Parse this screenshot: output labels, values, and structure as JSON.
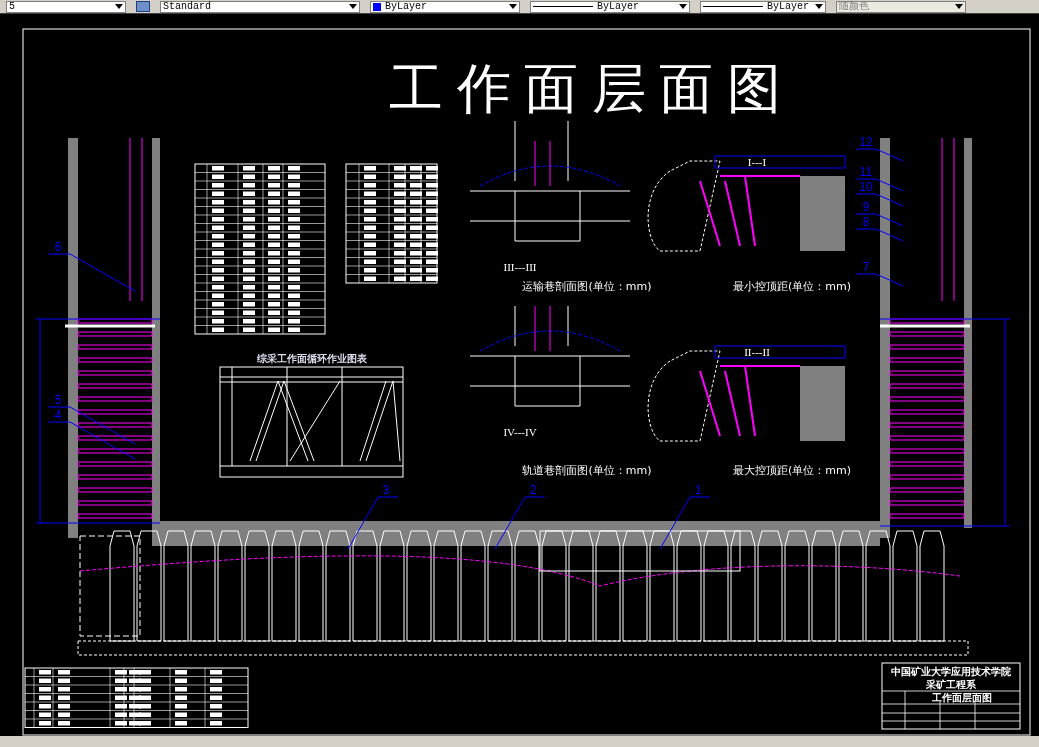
{
  "toolbar": [
    {
      "kind": "text-style",
      "value": "5"
    },
    {
      "kind": "dim-style",
      "value": "Standard"
    },
    {
      "kind": "color",
      "value": "ByLayer"
    },
    {
      "kind": "linetype",
      "value": "ByLayer"
    },
    {
      "kind": "lineweight",
      "value": "ByLayer"
    },
    {
      "kind": "plot-style",
      "value": "随颜色",
      "disabled": true
    }
  ],
  "drawing": {
    "title": "工 作 面 层 面 图",
    "chart_title": "综采工作面循环作业图表",
    "sections": [
      {
        "mark": "III---III",
        "caption": "运输巷剖面图(单位：mm)"
      },
      {
        "mark": "I---I",
        "caption": "最小控顶距(单位：mm)"
      },
      {
        "mark": "IV---IV",
        "caption": "轨道巷剖面图(单位：mm)"
      },
      {
        "mark": "II---II",
        "caption": "最大控顶距(单位：mm)"
      }
    ],
    "callouts": [
      "3",
      "2",
      "1",
      "6",
      "5",
      "4",
      "12",
      "11",
      "10",
      "9",
      "8",
      "7"
    ],
    "title_block": {
      "school": "中国矿业大学应用技术学院",
      "department": "采矿工程系",
      "drawing_name": "工作面层面图"
    }
  }
}
